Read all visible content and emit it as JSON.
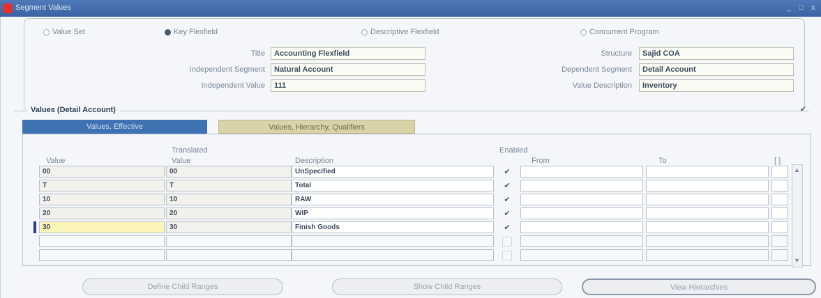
{
  "window": {
    "title": "Segment Values",
    "controls": [
      "_",
      "□",
      "x"
    ]
  },
  "source": {
    "options": [
      {
        "label": "Value Set",
        "selected": false
      },
      {
        "label": "Key Flexfield",
        "selected": true
      },
      {
        "label": "Descriptive Flexfield",
        "selected": false
      },
      {
        "label": "Concurrent Program",
        "selected": false
      }
    ]
  },
  "fields": {
    "title_label": "Title",
    "title_value": "Accounting Flexfield",
    "indep_segment_label": "Independent Segment",
    "indep_segment_value": "Natural Account",
    "indep_value_label": "Independent Value",
    "indep_value_value": "111",
    "structure_label": "Structure",
    "structure_value": "Sajid COA",
    "dep_segment_label": "Dependent Segment",
    "dep_segment_value": "Detail Account",
    "value_desc_label": "Value Description",
    "value_desc_value": "Inventory"
  },
  "section": {
    "title": "Values (Detail Account)"
  },
  "tabs": [
    {
      "label": "Values, Effective",
      "active": true
    },
    {
      "label": "Values, Hierarchy, Qualifiers",
      "active": false
    }
  ],
  "columns": {
    "value": "Value",
    "translated_1": "Translated",
    "translated_2": "Value",
    "description": "Description",
    "enabled": "Enabled",
    "from": "From",
    "to": "To",
    "flex": "[ ]"
  },
  "rows": [
    {
      "value": "00",
      "translated": "00",
      "description": "UnSpecified",
      "enabled": true
    },
    {
      "value": "T",
      "translated": "T",
      "description": "Total",
      "enabled": true
    },
    {
      "value": "10",
      "translated": "10",
      "description": "RAW",
      "enabled": true
    },
    {
      "value": "20",
      "translated": "20",
      "description": "WIP",
      "enabled": true
    },
    {
      "value": "30",
      "translated": "30",
      "description": "Finish Goods",
      "enabled": true
    },
    {
      "value": "",
      "translated": "",
      "description": "",
      "enabled": false
    },
    {
      "value": "",
      "translated": "",
      "description": "",
      "enabled": false
    }
  ],
  "buttons": {
    "define_child": "Define Child Ranges",
    "show_child": "Show Child Ranges",
    "view_hierarchies": "View Hierarchies"
  }
}
